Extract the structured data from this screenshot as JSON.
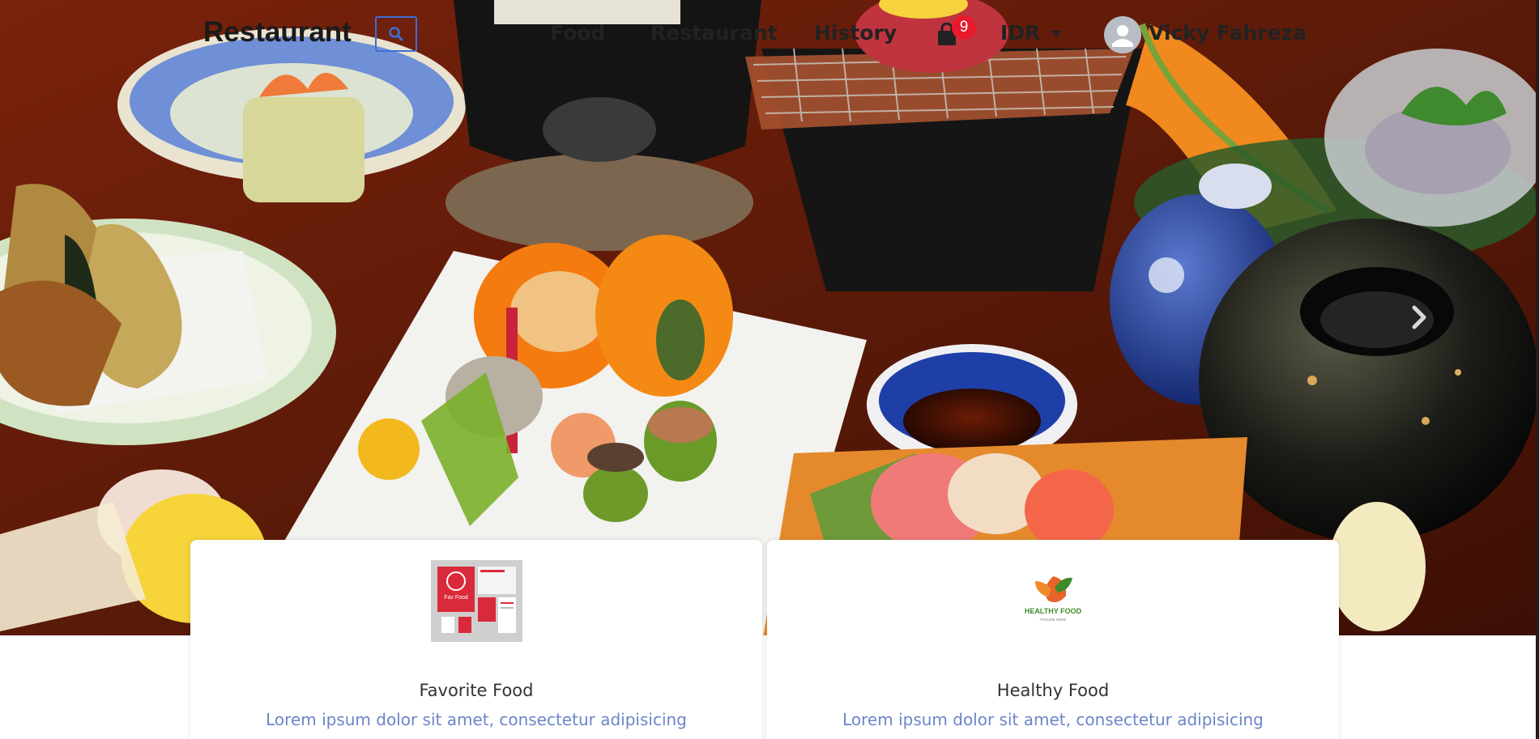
{
  "navbar": {
    "brand": "Restaurant",
    "links": [
      "Food",
      "Restaurant",
      "History"
    ],
    "cart_count": "9",
    "currency": "IDR",
    "user_name": "Vicky Fahreza"
  },
  "hero": {
    "next_icon": "chevron-right-icon"
  },
  "cards": [
    {
      "title": "Favorite Food",
      "description": "Lorem ipsum dolor sit amet, consectetur adipisicing",
      "logo_text": "Fav Food"
    },
    {
      "title": "Healthy Food",
      "description": "Lorem ipsum dolor sit amet, consectetur adipisicing",
      "logo_text": "HEALTHY FOOD",
      "logo_tagline": "TAGLINE HERE"
    }
  ],
  "colors": {
    "accent": "#3b6fd8",
    "badge": "#e8192c",
    "link_text": "#6b85c9"
  }
}
